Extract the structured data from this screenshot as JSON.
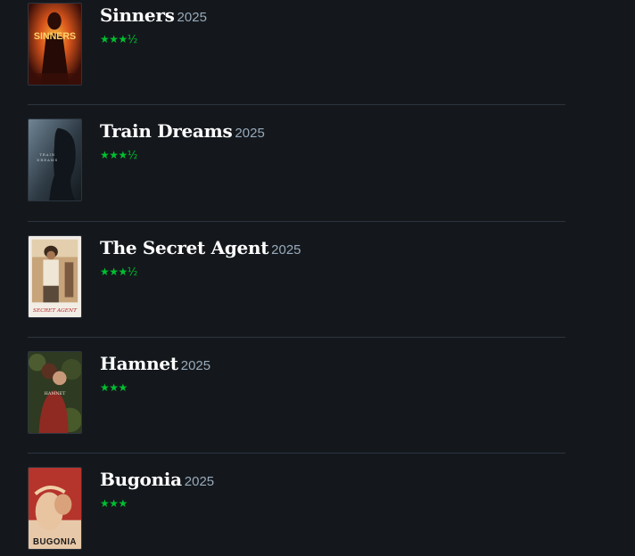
{
  "films": [
    {
      "title": "Sinners",
      "year": "2025",
      "rating": "★★★½",
      "poster_icon": "sinners-poster",
      "poster_text": "SINNERS"
    },
    {
      "title": "Train Dreams",
      "year": "2025",
      "rating": "★★★½",
      "poster_icon": "train-dreams-poster",
      "poster_text": "TRAIN DREAMS"
    },
    {
      "title": "The Secret Agent",
      "year": "2025",
      "rating": "★★★½",
      "poster_icon": "secret-agent-poster",
      "poster_text": "SECRET AGENT"
    },
    {
      "title": "Hamnet",
      "year": "2025",
      "rating": "★★★",
      "poster_icon": "hamnet-poster",
      "poster_text": "HAMNET"
    },
    {
      "title": "Bugonia",
      "year": "2025",
      "rating": "★★★",
      "poster_icon": "bugonia-poster",
      "poster_text": "BUGONIA"
    }
  ],
  "colors": {
    "background": "#14181c",
    "star_green": "#00c030",
    "year_grey": "#99aabb",
    "divider": "#2c3440"
  }
}
